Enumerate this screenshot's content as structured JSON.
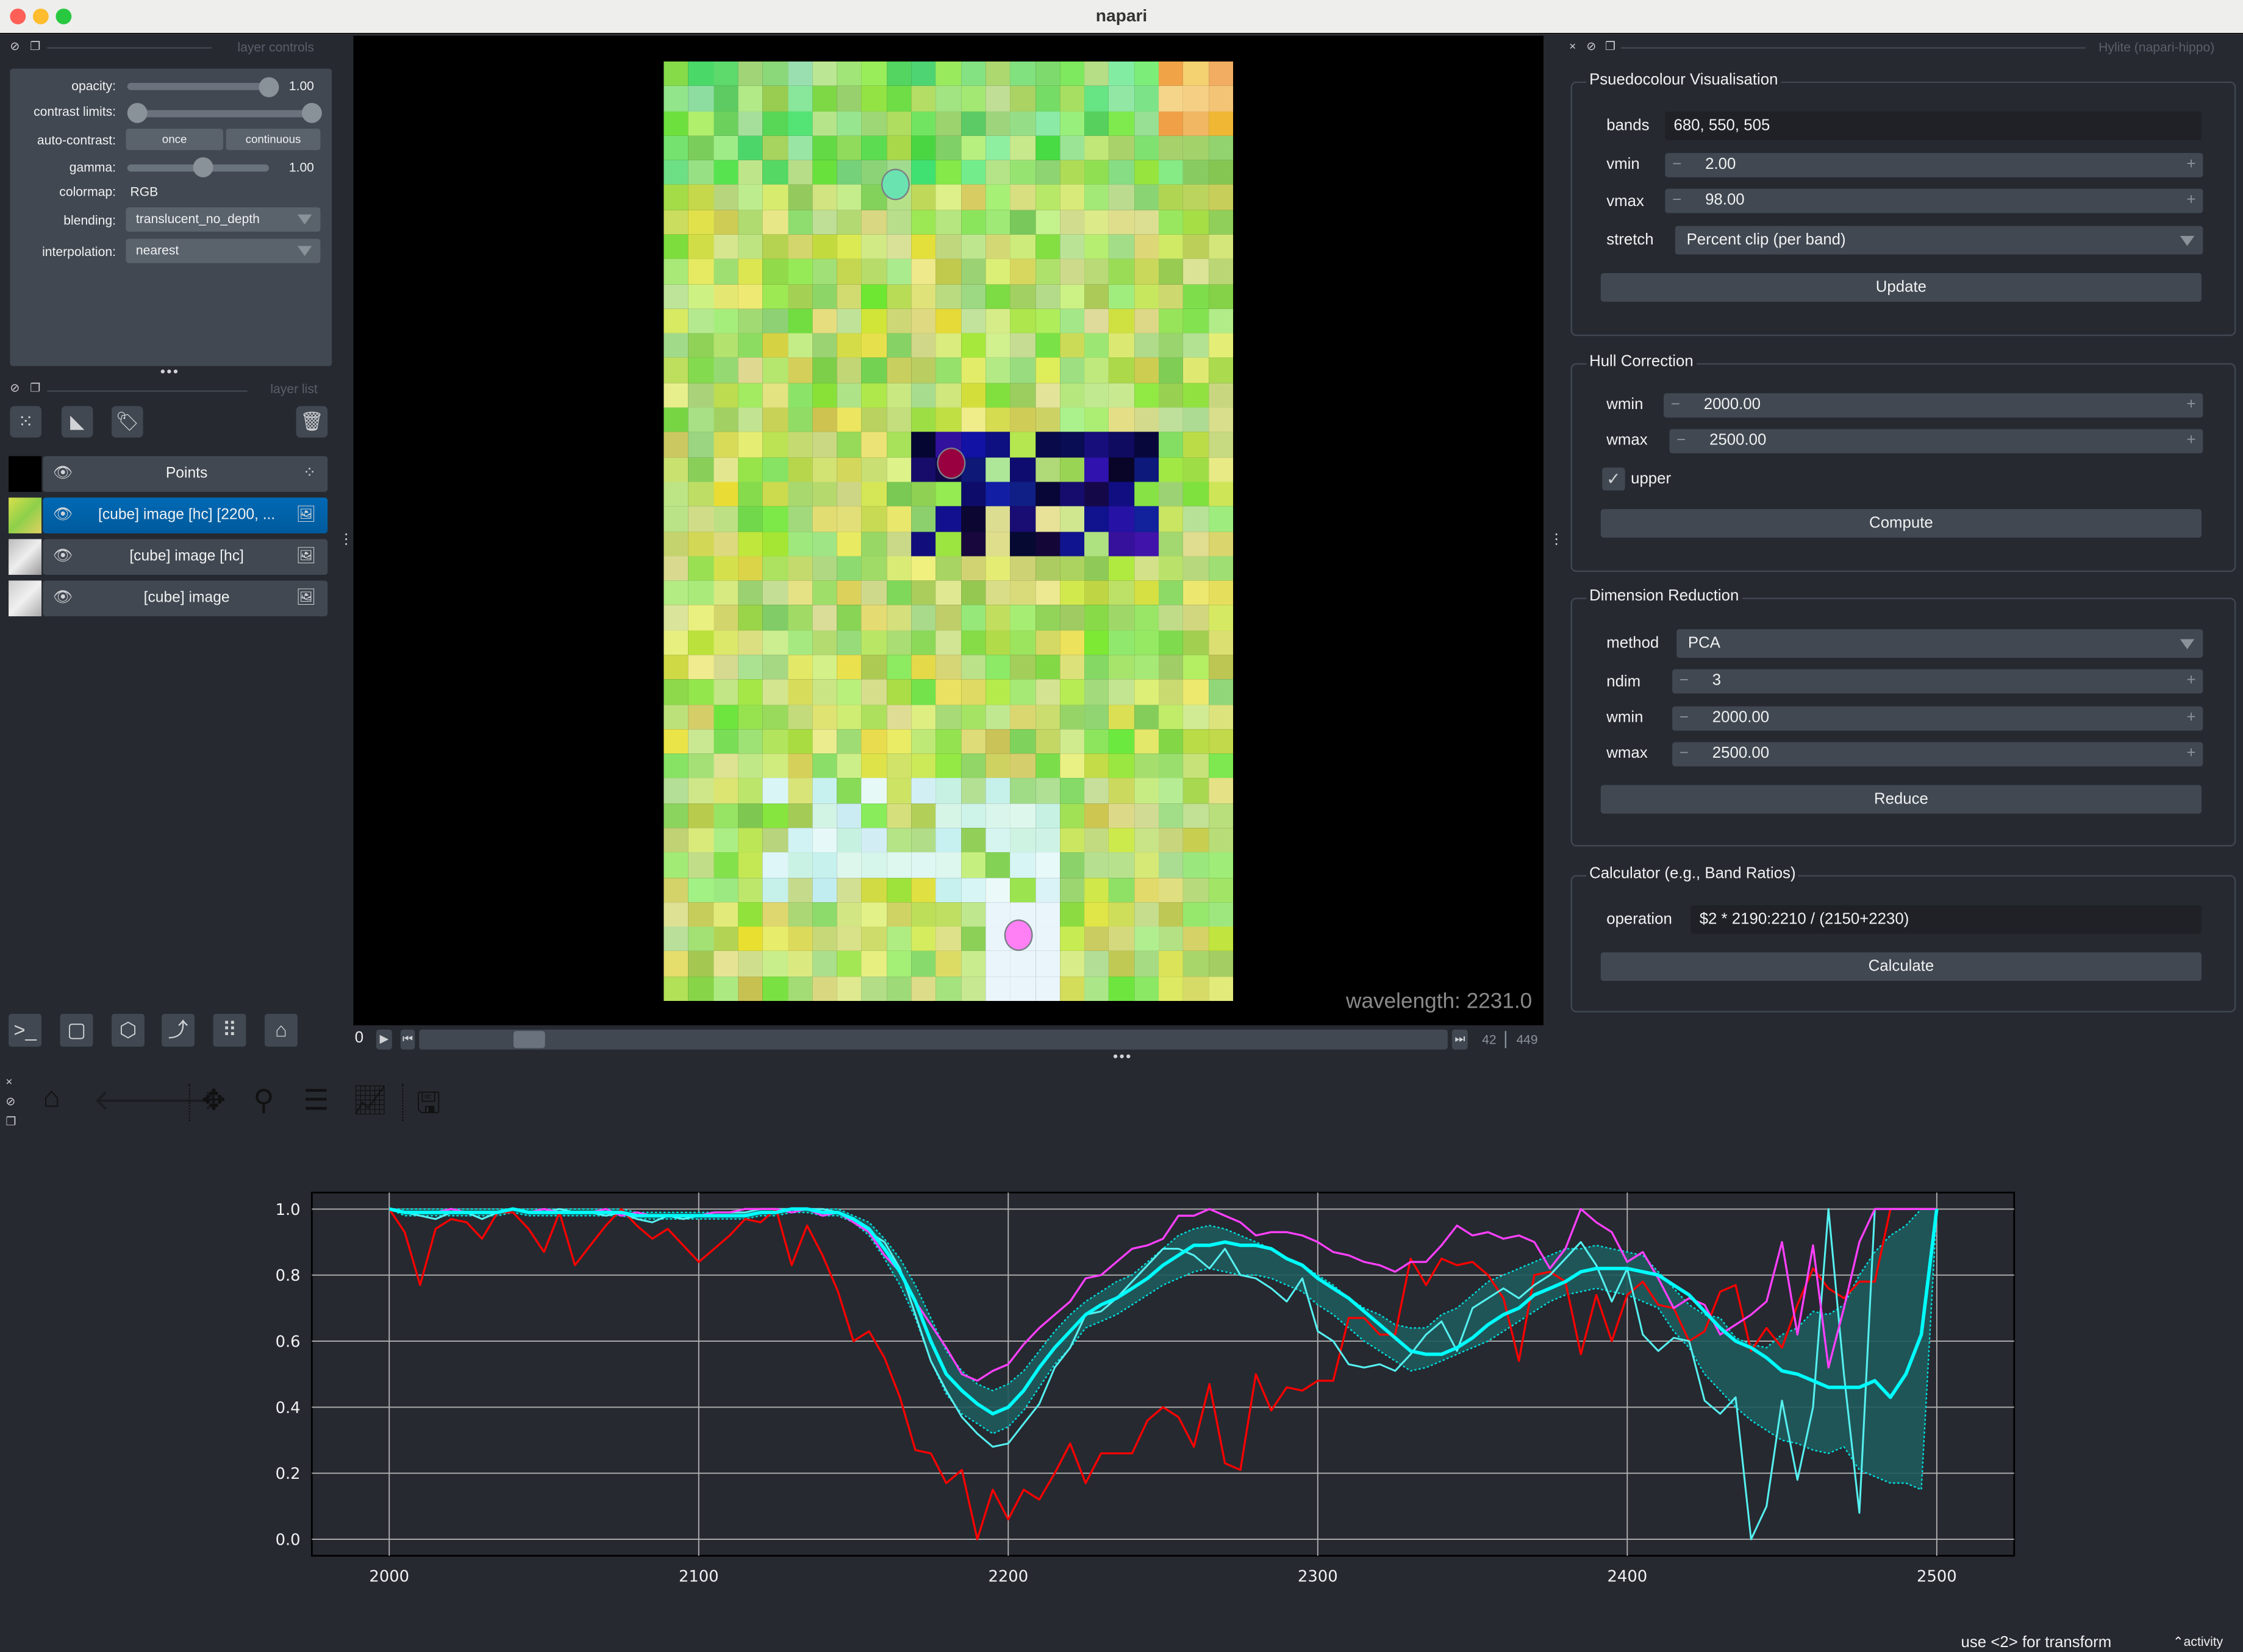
{
  "window": {
    "title": "napari"
  },
  "layer_controls": {
    "dock_title": "layer controls",
    "opacity_label": "opacity:",
    "opacity_value": "1.00",
    "opacity_fraction": 1.0,
    "contrast_label": "contrast limits:",
    "contrast_range": [
      0.0,
      1.0
    ],
    "autocontrast_label": "auto-contrast:",
    "once_label": "once",
    "continuous_label": "continuous",
    "gamma_label": "gamma:",
    "gamma_value": "1.00",
    "gamma_fraction": 0.5,
    "colormap_label": "colormap:",
    "colormap_value": "RGB",
    "blending_label": "blending:",
    "blending_value": "translucent_no_depth",
    "interpolation_label": "interpolation:",
    "interpolation_value": "nearest"
  },
  "layer_list": {
    "dock_title": "layer list",
    "layers": [
      {
        "name": "Points",
        "type": "points",
        "selected": false
      },
      {
        "name": "[cube] image [hc] [2200, ...",
        "type": "image",
        "selected": true
      },
      {
        "name": "[cube] image [hc]",
        "type": "image",
        "selected": false
      },
      {
        "name": "[cube] image",
        "type": "image",
        "selected": false
      }
    ]
  },
  "viewer": {
    "overlay_text": "wavelength: 2231.0",
    "dims_slider": {
      "axis_label": "0",
      "current": "42",
      "max": "449",
      "position_fraction": 0.094
    },
    "points": [
      {
        "color": "#6be3b0"
      },
      {
        "color": "#990040"
      },
      {
        "color": "#ff80f5"
      }
    ]
  },
  "viewer_buttons": [
    "console",
    "ndisplay",
    "roll-3d",
    "transpose",
    "grid",
    "home"
  ],
  "plugin": {
    "dock_title": "Hylite (napari-hippo)",
    "pseudocolour": {
      "title": "Psuedocolour Visualisation",
      "bands_label": "bands",
      "bands_value": "680, 550, 505",
      "vmin_label": "vmin",
      "vmin_value": "2.00",
      "vmax_label": "vmax",
      "vmax_value": "98.00",
      "stretch_label": "stretch",
      "stretch_value": "Percent clip (per band)",
      "button": "Update"
    },
    "hull": {
      "title": "Hull Correction",
      "wmin_label": "wmin",
      "wmin_value": "2000.00",
      "wmax_label": "wmax",
      "wmax_value": "2500.00",
      "upper_label": "upper",
      "upper_checked": true,
      "button": "Compute"
    },
    "dimred": {
      "title": "Dimension Reduction",
      "method_label": "method",
      "method_value": "PCA",
      "ndim_label": "ndim",
      "ndim_value": "3",
      "wmin_label": "wmin",
      "wmin_value": "2000.00",
      "wmax_label": "wmax",
      "wmax_value": "2500.00",
      "button": "Reduce"
    },
    "calculator": {
      "title": "Calculator (e.g., Band Ratios)",
      "operation_label": "operation",
      "operation_value": "$2 * 2190:2210 / (2150+2230)",
      "button": "Calculate"
    }
  },
  "plot_toolbar": [
    "home",
    "back",
    "forward",
    "pan",
    "zoom",
    "configure-subplots",
    "edit-axes",
    "save"
  ],
  "status": {
    "hint": "use <2> for transform",
    "activity": "activity"
  },
  "chart_data": {
    "type": "line",
    "title": "",
    "xlabel": "",
    "ylabel": "",
    "xlim": [
      1975,
      2525
    ],
    "ylim": [
      -0.05,
      1.05
    ],
    "xticks": [
      2000,
      2100,
      2200,
      2300,
      2400,
      2500
    ],
    "yticks": [
      0.0,
      0.2,
      0.4,
      0.6,
      0.8,
      1.0
    ],
    "ytick_labels": [
      "0.0",
      "0.2",
      "0.4",
      "0.6",
      "0.8",
      "1.0"
    ],
    "grid": true,
    "x": [
      2000,
      2005,
      2010,
      2015,
      2020,
      2025,
      2030,
      2035,
      2040,
      2045,
      2050,
      2055,
      2060,
      2065,
      2070,
      2075,
      2080,
      2085,
      2090,
      2095,
      2100,
      2105,
      2110,
      2115,
      2120,
      2125,
      2130,
      2135,
      2140,
      2145,
      2150,
      2155,
      2160,
      2165,
      2170,
      2175,
      2180,
      2185,
      2190,
      2195,
      2200,
      2205,
      2210,
      2215,
      2220,
      2225,
      2230,
      2235,
      2240,
      2245,
      2250,
      2255,
      2260,
      2265,
      2270,
      2275,
      2280,
      2285,
      2290,
      2295,
      2300,
      2305,
      2310,
      2315,
      2320,
      2325,
      2330,
      2335,
      2340,
      2345,
      2350,
      2355,
      2360,
      2365,
      2370,
      2375,
      2380,
      2385,
      2390,
      2395,
      2400,
      2405,
      2410,
      2415,
      2420,
      2425,
      2430,
      2435,
      2440,
      2445,
      2450,
      2455,
      2460,
      2465,
      2470,
      2475,
      2480,
      2485,
      2490,
      2495,
      2500
    ],
    "series": [
      {
        "name": "point-red",
        "color": "#ff0000",
        "values": [
          1.0,
          0.93,
          0.77,
          0.94,
          0.97,
          0.96,
          0.91,
          0.99,
          0.99,
          0.94,
          0.87,
          0.99,
          0.83,
          0.89,
          0.95,
          1.0,
          0.95,
          0.91,
          0.94,
          0.89,
          0.84,
          0.88,
          0.92,
          0.97,
          0.96,
          1.0,
          0.83,
          0.95,
          0.86,
          0.75,
          0.6,
          0.63,
          0.55,
          0.43,
          0.27,
          0.26,
          0.17,
          0.21,
          0.0,
          0.15,
          0.06,
          0.15,
          0.12,
          0.2,
          0.29,
          0.17,
          0.26,
          0.26,
          0.26,
          0.36,
          0.4,
          0.37,
          0.28,
          0.47,
          0.23,
          0.21,
          0.5,
          0.39,
          0.46,
          0.45,
          0.48,
          0.48,
          0.67,
          0.67,
          0.62,
          0.62,
          0.85,
          0.77,
          0.85,
          0.83,
          0.84,
          0.8,
          0.73,
          0.54,
          0.8,
          0.81,
          0.78,
          0.56,
          0.74,
          0.6,
          0.74,
          0.78,
          0.71,
          0.7,
          0.6,
          0.63,
          0.75,
          0.77,
          0.57,
          0.64,
          0.58,
          0.71,
          0.82,
          0.76,
          0.73,
          0.78,
          0.78,
          1.0,
          1.0,
          1.0,
          1.0
        ]
      },
      {
        "name": "point-magenta",
        "color": "#ff40ff",
        "values": [
          1.0,
          0.99,
          0.99,
          0.99,
          1.0,
          0.99,
          0.99,
          0.99,
          1.0,
          0.99,
          1.0,
          0.99,
          0.99,
          0.99,
          1.0,
          0.98,
          0.99,
          0.98,
          0.98,
          0.98,
          0.98,
          0.99,
          0.99,
          1.0,
          1.0,
          1.0,
          0.99,
          1.0,
          0.98,
          0.99,
          0.96,
          0.93,
          0.86,
          0.81,
          0.72,
          0.65,
          0.58,
          0.5,
          0.48,
          0.51,
          0.53,
          0.59,
          0.64,
          0.68,
          0.72,
          0.79,
          0.8,
          0.84,
          0.88,
          0.89,
          0.91,
          0.98,
          0.98,
          1.0,
          0.98,
          0.96,
          0.92,
          0.93,
          0.93,
          0.92,
          0.9,
          0.87,
          0.86,
          0.84,
          0.83,
          0.81,
          0.84,
          0.84,
          0.89,
          0.95,
          0.92,
          0.93,
          0.91,
          0.92,
          0.9,
          0.82,
          0.88,
          1.0,
          0.96,
          0.93,
          0.84,
          0.87,
          0.79,
          0.7,
          0.73,
          0.71,
          0.62,
          0.65,
          0.68,
          0.72,
          0.9,
          0.62,
          0.89,
          0.52,
          0.7,
          0.9,
          1.0,
          1.0,
          1.0,
          1.0,
          1.0
        ]
      },
      {
        "name": "point-cyan",
        "color": "#55f0f0",
        "values": [
          1.0,
          0.99,
          0.98,
          0.97,
          0.99,
          0.99,
          0.97,
          0.99,
          1.0,
          0.99,
          0.99,
          1.0,
          0.99,
          0.99,
          0.98,
          0.99,
          0.97,
          0.96,
          0.98,
          0.97,
          0.98,
          0.99,
          0.99,
          0.99,
          1.0,
          1.0,
          1.0,
          1.0,
          1.0,
          0.99,
          0.97,
          0.93,
          0.9,
          0.82,
          0.68,
          0.54,
          0.45,
          0.37,
          0.32,
          0.28,
          0.29,
          0.35,
          0.41,
          0.52,
          0.58,
          0.68,
          0.69,
          0.73,
          0.78,
          0.83,
          0.88,
          0.88,
          0.86,
          0.82,
          0.88,
          0.8,
          0.79,
          0.76,
          0.72,
          0.79,
          0.63,
          0.6,
          0.53,
          0.52,
          0.53,
          0.51,
          0.56,
          0.62,
          0.66,
          0.57,
          0.7,
          0.73,
          0.76,
          0.73,
          0.77,
          0.8,
          0.85,
          0.9,
          0.83,
          0.72,
          0.82,
          0.62,
          0.57,
          0.61,
          0.6,
          0.42,
          0.38,
          0.43,
          0.0,
          0.1,
          0.42,
          0.18,
          0.4,
          1.0,
          0.5,
          0.08,
          1.0,
          1.0,
          1.0,
          1.0,
          1.0
        ]
      },
      {
        "name": "mean",
        "color": "#00ffff",
        "values": [
          1.0,
          0.99,
          0.99,
          0.99,
          0.99,
          0.99,
          0.99,
          0.99,
          1.0,
          0.99,
          0.99,
          0.99,
          0.99,
          0.99,
          0.99,
          0.99,
          0.98,
          0.98,
          0.98,
          0.98,
          0.98,
          0.98,
          0.98,
          0.98,
          0.99,
          0.99,
          1.0,
          1.0,
          0.99,
          0.99,
          0.97,
          0.94,
          0.88,
          0.81,
          0.72,
          0.6,
          0.5,
          0.45,
          0.41,
          0.38,
          0.4,
          0.45,
          0.52,
          0.58,
          0.63,
          0.68,
          0.71,
          0.73,
          0.76,
          0.79,
          0.83,
          0.86,
          0.89,
          0.89,
          0.9,
          0.89,
          0.89,
          0.88,
          0.85,
          0.83,
          0.79,
          0.76,
          0.73,
          0.69,
          0.65,
          0.61,
          0.57,
          0.56,
          0.56,
          0.58,
          0.61,
          0.65,
          0.68,
          0.7,
          0.74,
          0.76,
          0.78,
          0.81,
          0.82,
          0.82,
          0.82,
          0.81,
          0.8,
          0.77,
          0.74,
          0.69,
          0.64,
          0.6,
          0.58,
          0.55,
          0.51,
          0.5,
          0.48,
          0.46,
          0.46,
          0.46,
          0.48,
          0.43,
          0.5,
          0.62,
          1.0
        ]
      },
      {
        "name": "upper-band",
        "color": "#00e0e0",
        "values": [
          1.0,
          1.0,
          1.0,
          1.0,
          1.0,
          1.0,
          1.0,
          1.0,
          1.0,
          1.0,
          1.0,
          1.0,
          1.0,
          1.0,
          1.0,
          1.0,
          0.99,
          0.99,
          0.99,
          0.99,
          0.99,
          0.99,
          0.99,
          0.99,
          1.0,
          1.0,
          1.0,
          1.0,
          1.0,
          1.0,
          0.98,
          0.96,
          0.91,
          0.85,
          0.77,
          0.67,
          0.57,
          0.51,
          0.47,
          0.45,
          0.47,
          0.51,
          0.57,
          0.63,
          0.68,
          0.72,
          0.75,
          0.78,
          0.8,
          0.84,
          0.88,
          0.92,
          0.94,
          0.95,
          0.94,
          0.92,
          0.9,
          0.88,
          0.85,
          0.83,
          0.8,
          0.77,
          0.73,
          0.7,
          0.68,
          0.65,
          0.64,
          0.64,
          0.68,
          0.7,
          0.74,
          0.78,
          0.8,
          0.82,
          0.84,
          0.86,
          0.88,
          0.88,
          0.89,
          0.88,
          0.87,
          0.86,
          0.81,
          0.76,
          0.71,
          0.68,
          0.67,
          0.61,
          0.59,
          0.58,
          0.62,
          0.64,
          0.69,
          0.68,
          0.71,
          0.8,
          0.87,
          0.92,
          0.95,
          1.0,
          1.0
        ]
      },
      {
        "name": "lower-band",
        "color": "#00e0e0",
        "values": [
          1.0,
          0.98,
          0.98,
          0.98,
          0.98,
          0.98,
          0.98,
          0.98,
          0.99,
          0.98,
          0.98,
          0.98,
          0.98,
          0.98,
          0.98,
          0.98,
          0.97,
          0.97,
          0.97,
          0.97,
          0.97,
          0.97,
          0.97,
          0.97,
          0.98,
          0.98,
          0.99,
          0.99,
          0.98,
          0.98,
          0.96,
          0.92,
          0.85,
          0.77,
          0.67,
          0.54,
          0.44,
          0.38,
          0.35,
          0.32,
          0.34,
          0.39,
          0.46,
          0.53,
          0.58,
          0.64,
          0.66,
          0.68,
          0.71,
          0.74,
          0.77,
          0.79,
          0.81,
          0.82,
          0.81,
          0.8,
          0.8,
          0.79,
          0.77,
          0.75,
          0.71,
          0.68,
          0.64,
          0.6,
          0.57,
          0.54,
          0.51,
          0.52,
          0.54,
          0.56,
          0.58,
          0.6,
          0.63,
          0.66,
          0.69,
          0.72,
          0.74,
          0.75,
          0.76,
          0.75,
          0.74,
          0.72,
          0.7,
          0.63,
          0.58,
          0.5,
          0.45,
          0.4,
          0.36,
          0.33,
          0.3,
          0.29,
          0.27,
          0.26,
          0.28,
          0.21,
          0.19,
          0.17,
          0.17,
          0.15,
          1.0
        ]
      }
    ]
  }
}
